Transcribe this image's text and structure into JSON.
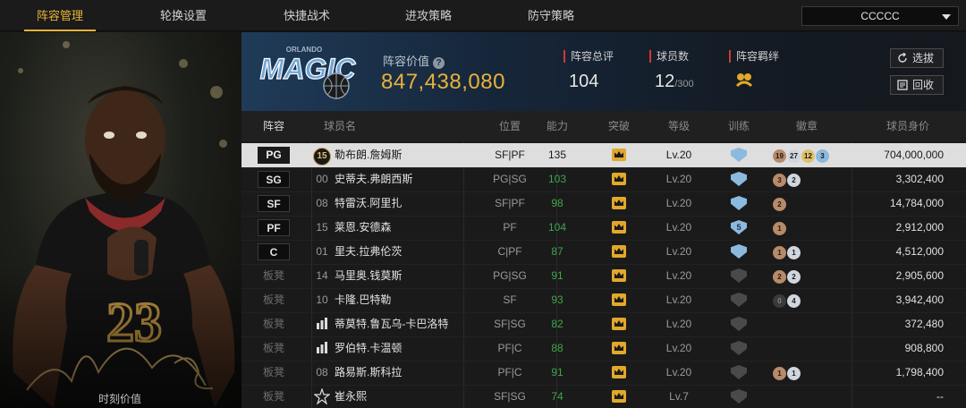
{
  "nav": {
    "tabs": [
      "阵容管理",
      "轮换设置",
      "快捷战术",
      "进攻策略",
      "防守策略"
    ],
    "active_tab": 0,
    "roster_select": "CCCCC"
  },
  "hero": {
    "jersey_number": "23",
    "time_value_label": "时刻价值"
  },
  "team": {
    "logo_text": "MAGIC",
    "logo_subtext": "ORLANDO",
    "value_label": "阵容价值",
    "value": "847,438,080",
    "rating_label": "阵容总评",
    "rating": "104",
    "player_count_label": "球员数",
    "player_count": "12",
    "player_count_max": "/300",
    "bond_label": "阵容羁绊",
    "pick_button": "选拔",
    "recycle_button": "回收"
  },
  "table": {
    "headers": [
      "阵容",
      "球员名",
      "位置",
      "能力",
      "突破",
      "等级",
      "训练",
      "徽章",
      "球员身价"
    ],
    "rows": [
      {
        "pos": "PG",
        "num": "15",
        "name": "勒布朗.詹姆斯",
        "role": "SF|PF",
        "ability": "135",
        "level": "Lv.20",
        "training": "",
        "badges": [
          {
            "t": "bronze",
            "v": "19"
          },
          {
            "t": "silver",
            "v": "27"
          },
          {
            "t": "gold",
            "v": "12"
          },
          {
            "t": "blue",
            "v": "3"
          }
        ],
        "price": "704,000,000",
        "type": "sel",
        "numtype": "badge"
      },
      {
        "pos": "SG",
        "num": "00",
        "name": "史蒂夫.弗朗西斯",
        "role": "PG|SG",
        "ability": "103",
        "level": "Lv.20",
        "training": "",
        "badges": [
          {
            "t": "bronze",
            "v": "3"
          },
          {
            "t": "silver",
            "v": "2"
          }
        ],
        "price": "3,302,400",
        "type": "starter",
        "numtype": "text"
      },
      {
        "pos": "SF",
        "num": "08",
        "name": "特雷沃.阿里扎",
        "role": "SF|PF",
        "ability": "98",
        "level": "Lv.20",
        "training": "",
        "badges": [
          {
            "t": "bronze",
            "v": "2"
          }
        ],
        "price": "14,784,000",
        "type": "starter",
        "numtype": "text"
      },
      {
        "pos": "PF",
        "num": "15",
        "name": "莱恩.安德森",
        "role": "PF",
        "ability": "104",
        "level": "Lv.20",
        "training": "5",
        "badges": [
          {
            "t": "bronze",
            "v": "1"
          }
        ],
        "price": "2,912,000",
        "type": "starter",
        "numtype": "text"
      },
      {
        "pos": "C",
        "num": "01",
        "name": "里夫.拉弗伦茨",
        "role": "C|PF",
        "ability": "87",
        "level": "Lv.20",
        "training": "",
        "badges": [
          {
            "t": "bronze",
            "v": "1"
          },
          {
            "t": "silver",
            "v": "1"
          }
        ],
        "price": "4,512,000",
        "type": "starter",
        "numtype": "text"
      },
      {
        "pos": "板凳",
        "num": "14",
        "name": "马里奥.钱莫斯",
        "role": "PG|SG",
        "ability": "91",
        "level": "Lv.20",
        "training": "",
        "badges": [
          {
            "t": "bronze",
            "v": "2"
          },
          {
            "t": "silver",
            "v": "2"
          }
        ],
        "price": "2,905,600",
        "type": "bench",
        "numtype": "text"
      },
      {
        "pos": "板凳",
        "num": "10",
        "name": "卡隆.巴特勒",
        "role": "SF",
        "ability": "93",
        "level": "Lv.20",
        "training": "",
        "badges": [
          {
            "t": "dark",
            "v": "0"
          },
          {
            "t": "silver",
            "v": "4"
          }
        ],
        "price": "3,942,400",
        "type": "bench",
        "numtype": "text"
      },
      {
        "pos": "板凳",
        "num": "",
        "name": "蒂莫特.鲁瓦乌-卡巴洛特",
        "role": "SF|SG",
        "ability": "82",
        "level": "Lv.20",
        "training": "",
        "badges": [],
        "price": "372,480",
        "type": "bench",
        "numtype": "icon"
      },
      {
        "pos": "板凳",
        "num": "",
        "name": "罗伯特.卡温顿",
        "role": "PF|C",
        "ability": "88",
        "level": "Lv.20",
        "training": "",
        "badges": [],
        "price": "908,800",
        "type": "bench",
        "numtype": "icon"
      },
      {
        "pos": "板凳",
        "num": "08",
        "name": "路易斯.斯科拉",
        "role": "PF|C",
        "ability": "91",
        "level": "Lv.20",
        "training": "",
        "badges": [
          {
            "t": "bronze",
            "v": "1"
          },
          {
            "t": "silver",
            "v": "1"
          }
        ],
        "price": "1,798,400",
        "type": "bench",
        "numtype": "text"
      },
      {
        "pos": "板凳",
        "num": "",
        "name": "崔永熙",
        "role": "SF|SG",
        "ability": "74",
        "level": "Lv.7",
        "training": "",
        "badges": [],
        "price": "--",
        "type": "bench",
        "numtype": "star"
      }
    ]
  },
  "colors": {
    "accent_gold": "#e8b23a",
    "ability_green": "#3fa64a",
    "label_red": "#d23a2a"
  },
  "icons": [
    "dropdown-caret-icon",
    "help-icon",
    "refresh-icon",
    "recycle-icon",
    "bond-icon",
    "crown-icon",
    "shield-icon",
    "badge-icon",
    "star-icon"
  ]
}
